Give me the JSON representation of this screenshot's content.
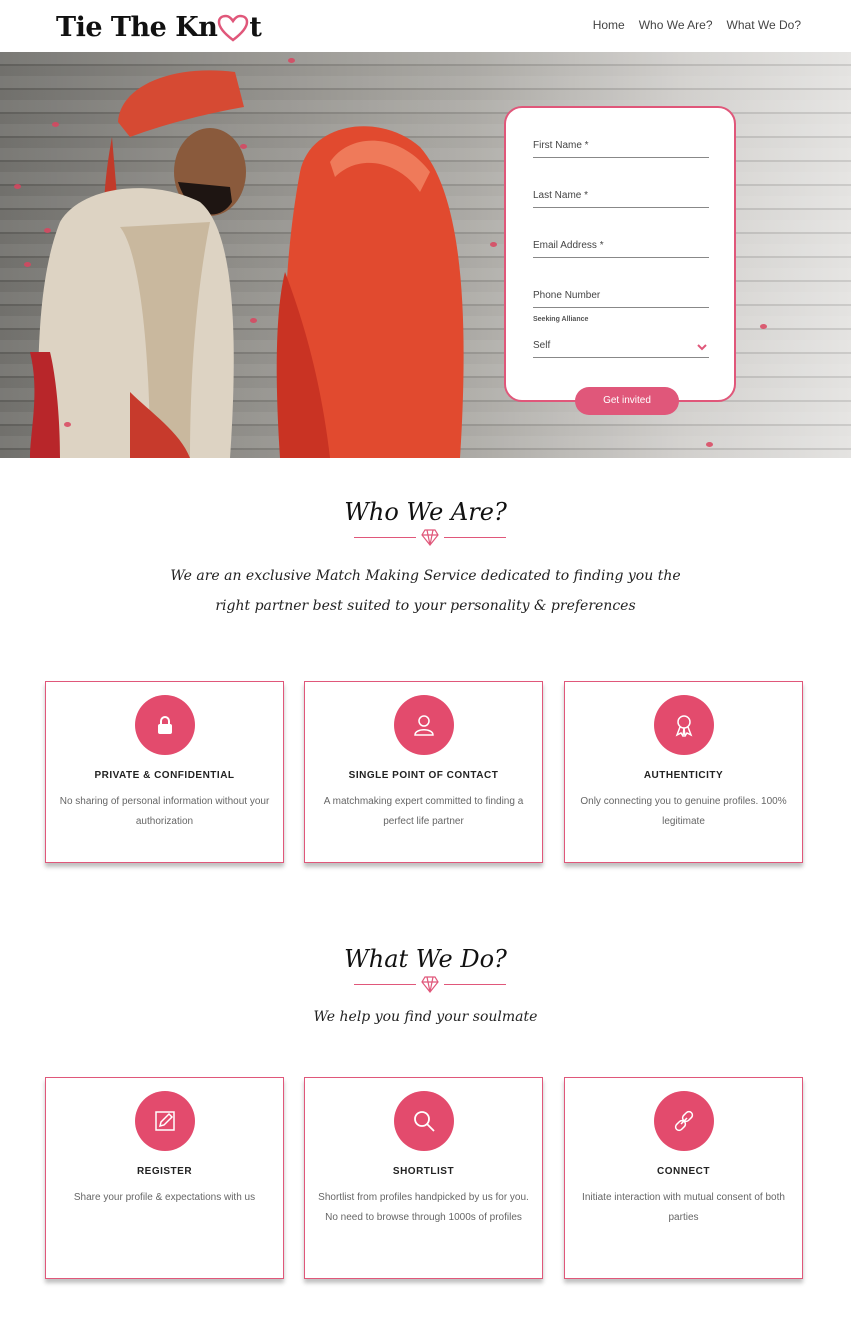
{
  "header": {
    "logo_text_before": "Tie The Kn",
    "logo_text_after": "t",
    "nav": [
      "Home",
      "Who We Are?",
      "What We Do?"
    ]
  },
  "hero": {
    "form": {
      "first_name": "First Name *",
      "last_name": "Last Name *",
      "email": "Email Address *",
      "phone": "Phone Number",
      "seeking_label": "Seeking Alliance",
      "seeking_value": "Self",
      "submit": "Get invited"
    }
  },
  "who": {
    "title": "Who We Are?",
    "tagline_line1": "We are an exclusive Match Making Service dedicated to finding you the",
    "tagline_line2": "right partner best suited to your personality & preferences",
    "cards": [
      {
        "icon": "lock-icon",
        "title": "PRIVATE & CONFIDENTIAL",
        "desc": "No sharing of personal information without your authorization"
      },
      {
        "icon": "user-icon",
        "title": "SINGLE POINT OF CONTACT",
        "desc": "A matchmaking expert committed to finding a perfect life partner"
      },
      {
        "icon": "award-icon",
        "title": "AUTHENTICITY",
        "desc": "Only connecting you to genuine profiles. 100% legitimate"
      }
    ]
  },
  "what": {
    "title": "What We Do?",
    "tagline": "We  help you find your soulmate",
    "cards": [
      {
        "icon": "edit-icon",
        "title": "REGISTER",
        "desc": "Share your profile & expectations with us"
      },
      {
        "icon": "search-icon",
        "title": "SHORTLIST",
        "desc": "Shortlist from profiles handpicked by us for you. No need to browse through 1000s of profiles"
      },
      {
        "icon": "link-icon",
        "title": "CONNECT",
        "desc": "Initiate interaction with mutual consent of both parties"
      }
    ]
  },
  "colors": {
    "accent": "#e0577a",
    "icon_bg": "#e34b6d"
  }
}
